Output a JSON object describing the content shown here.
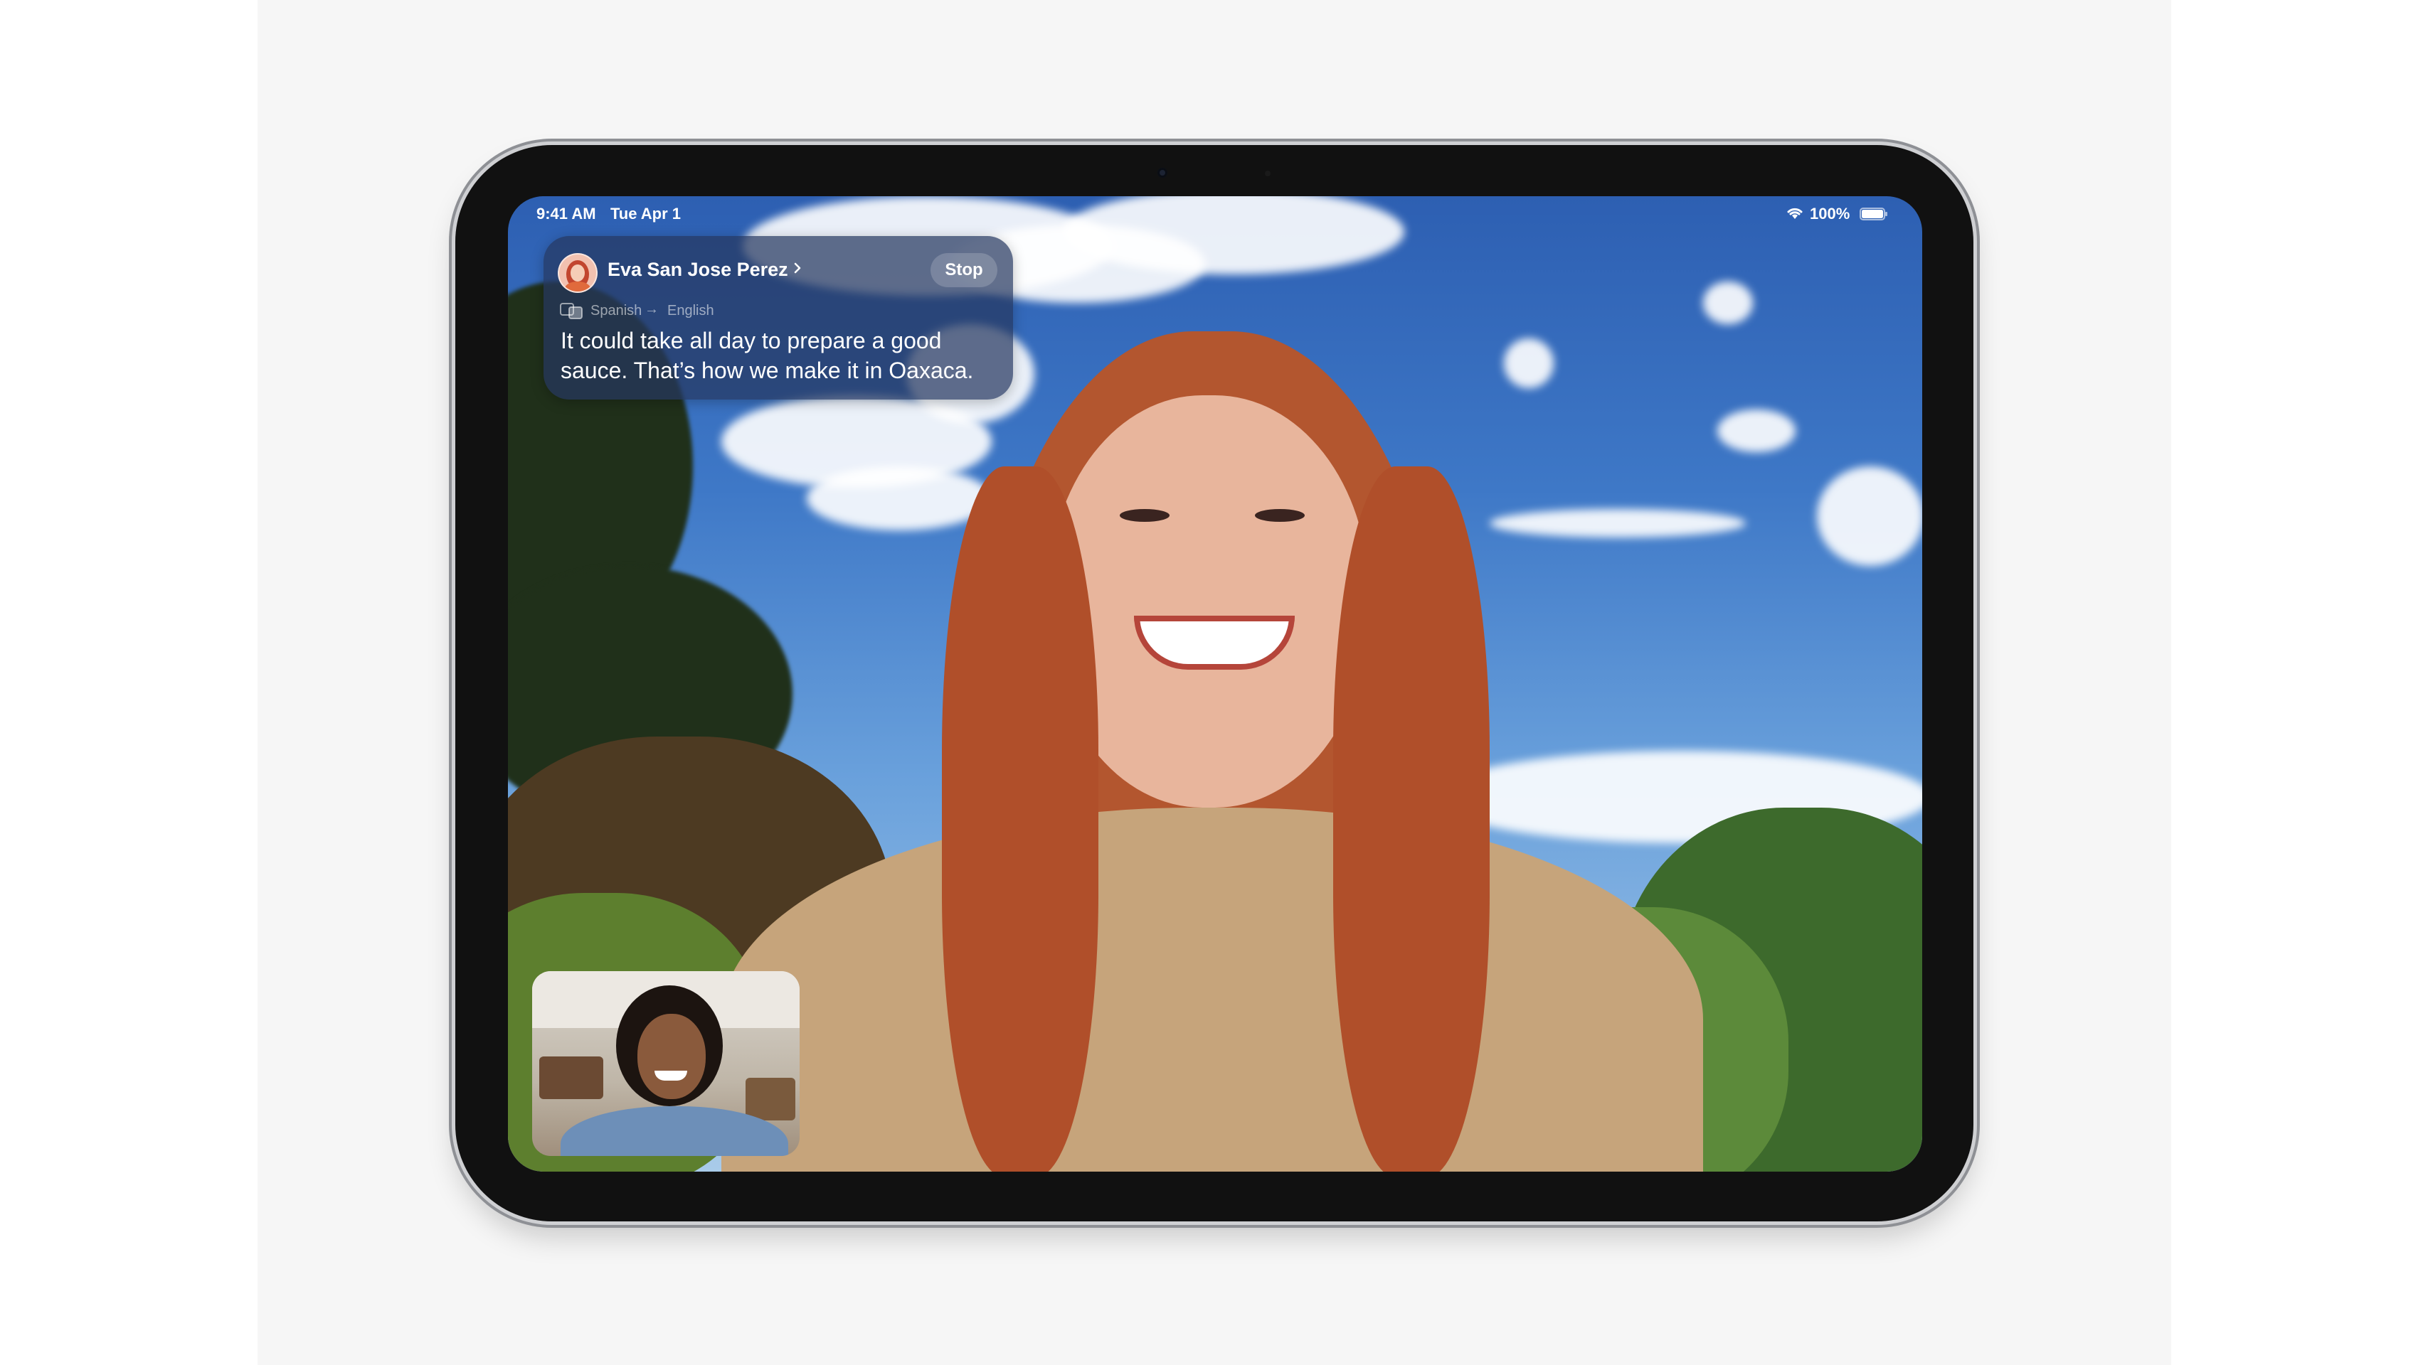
{
  "status_bar": {
    "time": "9:41 AM",
    "date": "Tue Apr 1",
    "battery": "100%",
    "icons": [
      "wifi-icon",
      "battery-icon"
    ]
  },
  "caption": {
    "caller_name": "Eva San Jose Perez",
    "stop_label": "Stop",
    "from_language": "Spanish",
    "arrow": "→",
    "to_language": "English",
    "text": "It could take all day to prepare a good sauce. That’s how we make it in Oaxaca.",
    "icons": [
      "avatar",
      "chevron-right-icon",
      "translate-icon"
    ]
  },
  "video": {
    "remote_view": "caller-video",
    "self_view": "self-view-pip"
  },
  "colors": {
    "caption_bg": "#263860",
    "accent_white": "#ffffff",
    "sky": "#3e78c7"
  }
}
